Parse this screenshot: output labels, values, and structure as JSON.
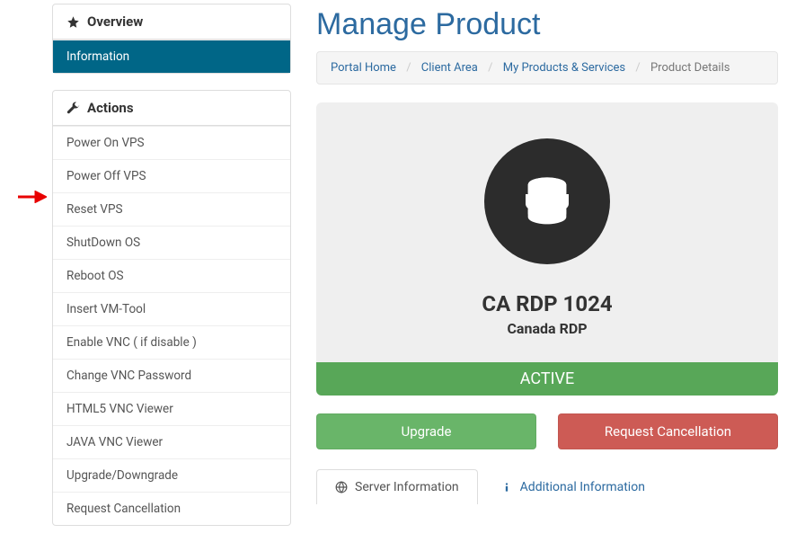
{
  "sidebar": {
    "overview": {
      "title": "Overview",
      "items": [
        "Information"
      ]
    },
    "actions": {
      "title": "Actions",
      "items": [
        "Power On VPS",
        "Power Off VPS",
        "Reset VPS",
        "ShutDown OS",
        "Reboot OS",
        "Insert VM-Tool",
        "Enable VNC ( if disable )",
        "Change VNC Password",
        "HTML5 VNC Viewer",
        "JAVA VNC Viewer",
        "Upgrade/Downgrade",
        "Request Cancellation"
      ]
    }
  },
  "page": {
    "title": "Manage Product",
    "breadcrumb": {
      "items": [
        "Portal Home",
        "Client Area",
        "My Products & Services"
      ],
      "current": "Product Details"
    }
  },
  "product": {
    "name": "CA RDP 1024",
    "group": "Canada RDP",
    "status": "ACTIVE"
  },
  "buttons": {
    "upgrade": "Upgrade",
    "cancel": "Request Cancellation"
  },
  "tabs": {
    "server_info": "Server Information",
    "additional_info": "Additional Information"
  }
}
